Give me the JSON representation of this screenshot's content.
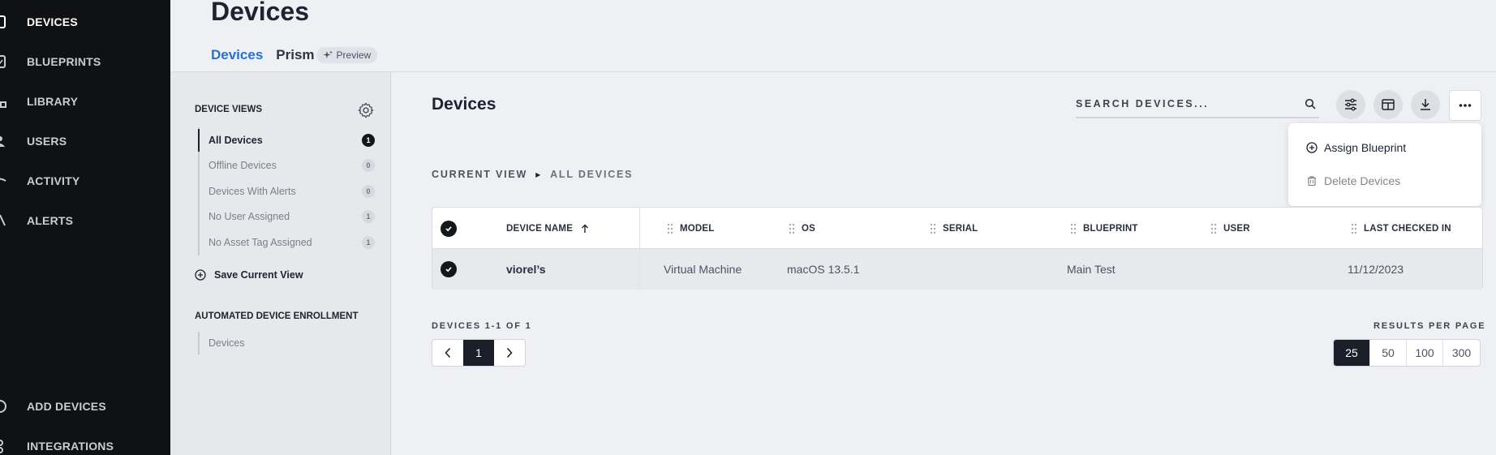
{
  "nav": {
    "items": [
      {
        "label": "DEVICES",
        "icon": "device-icon",
        "active": true
      },
      {
        "label": "BLUEPRINTS",
        "icon": "blueprint-icon"
      },
      {
        "label": "LIBRARY",
        "icon": "library-icon"
      },
      {
        "label": "USERS",
        "icon": "user-icon"
      },
      {
        "label": "ACTIVITY",
        "icon": "activity-icon"
      },
      {
        "label": "ALERTS",
        "icon": "alert-icon"
      }
    ],
    "bottom": [
      {
        "label": "ADD DEVICES",
        "icon": "add-icon"
      },
      {
        "label": "INTEGRATIONS",
        "icon": "integrations-icon"
      }
    ]
  },
  "header": {
    "title": "Devices",
    "tabs": [
      {
        "label": "Devices",
        "active": true
      },
      {
        "label": "Prism"
      }
    ],
    "preview_badge": "Preview"
  },
  "views": {
    "title": "DEVICE VIEWS",
    "items": [
      {
        "label": "All Devices",
        "count": "1",
        "active": true
      },
      {
        "label": "Offline Devices",
        "count": "0"
      },
      {
        "label": "Devices With Alerts",
        "count": "0"
      },
      {
        "label": "No User Assigned",
        "count": "1"
      },
      {
        "label": "No Asset Tag Assigned",
        "count": "1"
      }
    ],
    "save_label": "Save Current View",
    "ade_title": "AUTOMATED DEVICE ENROLLMENT",
    "ade_items": [
      {
        "label": "Devices"
      }
    ]
  },
  "main": {
    "title": "Devices",
    "search_placeholder": "SEARCH DEVICES...",
    "breadcrumb": {
      "label": "CURRENT VIEW",
      "current": "ALL DEVICES"
    },
    "menu": {
      "items": [
        {
          "label": "Assign Blueprint",
          "icon": "plus-circle-icon"
        },
        {
          "label": "Delete Devices",
          "icon": "trash-icon"
        }
      ]
    },
    "table": {
      "columns": [
        "DEVICE NAME",
        "MODEL",
        "OS",
        "SERIAL",
        "BLUEPRINT",
        "USER",
        "LAST CHECKED IN"
      ],
      "rows": [
        {
          "device_name": "viorel’s",
          "model": "Virtual Machine",
          "os": "macOS 13.5.1",
          "serial": "",
          "blueprint": "Main Test",
          "user": "",
          "last_checked_in": "11/12/2023"
        }
      ]
    },
    "pagination": {
      "range": "DEVICES 1-1 OF 1",
      "current_page": "1",
      "rpp_label": "RESULTS PER PAGE",
      "rpp_options": [
        "25",
        "50",
        "100",
        "300"
      ],
      "rpp_selected": "25"
    }
  },
  "colors": {
    "nav_bg": "#101113",
    "accent": "#2b6ed6",
    "page_bg": "#eef0f4"
  }
}
